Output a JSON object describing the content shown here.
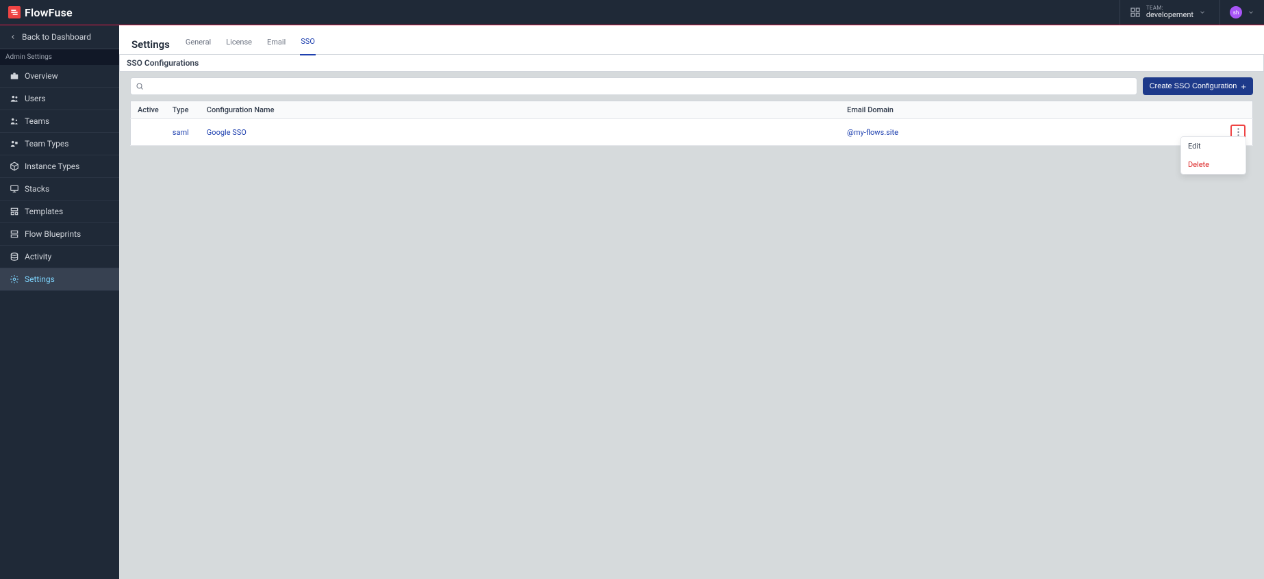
{
  "brand": "FlowFuse",
  "header": {
    "team_label": "TEAM:",
    "team_name": "developement",
    "user_initials": "sh"
  },
  "sidebar": {
    "back_label": "Back to Dashboard",
    "section_label": "Admin Settings",
    "items": [
      {
        "label": "Overview"
      },
      {
        "label": "Users"
      },
      {
        "label": "Teams"
      },
      {
        "label": "Team Types"
      },
      {
        "label": "Instance Types"
      },
      {
        "label": "Stacks"
      },
      {
        "label": "Templates"
      },
      {
        "label": "Flow Blueprints"
      },
      {
        "label": "Activity"
      },
      {
        "label": "Settings"
      }
    ]
  },
  "page": {
    "title": "Settings",
    "tabs": [
      {
        "label": "General"
      },
      {
        "label": "License"
      },
      {
        "label": "Email"
      },
      {
        "label": "SSO"
      }
    ],
    "section_title": "SSO Configurations",
    "create_button": "Create SSO Configuration",
    "columns": {
      "active": "Active",
      "type": "Type",
      "name": "Configuration Name",
      "domain": "Email Domain"
    },
    "rows": [
      {
        "active": "",
        "type": "saml",
        "name": "Google SSO",
        "domain": "@my-flows.site"
      }
    ],
    "dropdown": {
      "edit": "Edit",
      "delete": "Delete"
    }
  }
}
